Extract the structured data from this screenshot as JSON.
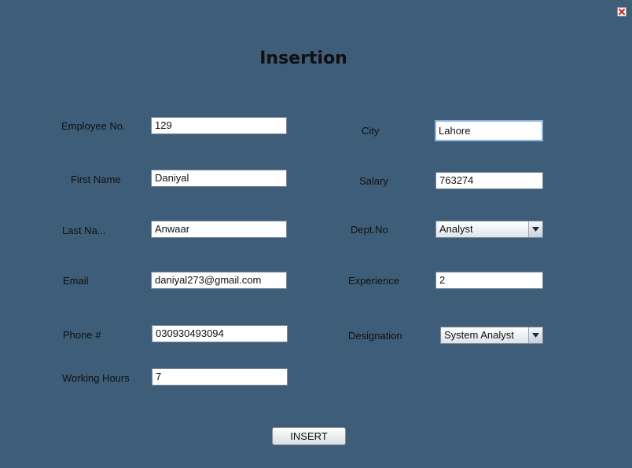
{
  "form": {
    "title": "Insertion",
    "fields": {
      "employee_no": {
        "label": "Employee No.",
        "value": "129"
      },
      "first_name": {
        "label": "First Name",
        "value": "Daniyal"
      },
      "last_name": {
        "label": "Last Na...",
        "value": "Anwaar"
      },
      "email": {
        "label": "Email",
        "value": "daniyal273@gmail.com"
      },
      "phone": {
        "label": "Phone #",
        "value": "030930493094"
      },
      "working_hours": {
        "label": "Working Hours",
        "value": "7"
      },
      "city": {
        "label": "City",
        "value": "Lahore"
      },
      "salary": {
        "label": "Salary",
        "value": "763274"
      },
      "dept_no": {
        "label": "Dept.No",
        "selected": "Analyst"
      },
      "experience": {
        "label": "Experience",
        "value": "2"
      },
      "designation": {
        "label": "Designation",
        "selected": "System Analyst"
      }
    },
    "insert_label": "INSERT"
  },
  "icons": {
    "close": "close-icon",
    "dropdown": "chevron-down-icon"
  },
  "colors": {
    "background": "#3e5d78",
    "close_icon": "#cc1f1f",
    "focus_border": "#8fb6e0"
  }
}
